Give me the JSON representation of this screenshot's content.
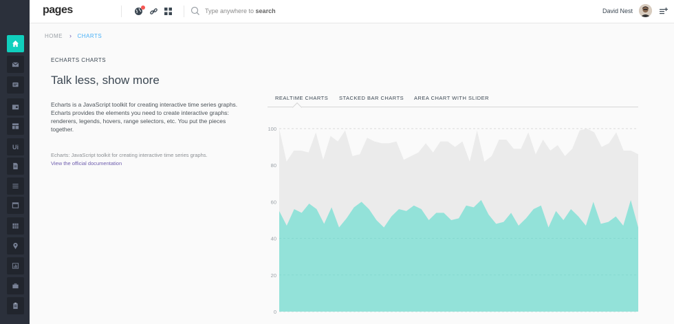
{
  "header": {
    "brand": "pages",
    "search_prefix": "Type anywhere to ",
    "search_keyword": "search",
    "user_name": "David Nest"
  },
  "breadcrumb": {
    "home": "HOME",
    "current": "CHARTS"
  },
  "content": {
    "section_label": "ECHARTS CHARTS",
    "title": "Talk less, show more",
    "description": "Echarts is a JavaScript toolkit for creating interactive time series graphs. Echarts provides the elements you need to create interactive graphs: renderers, legends, hovers, range selectors, etc. You put the pieces together.",
    "note": "Echarts: JavaScript toolkit for creating interactive time series graphs.",
    "doc_link": "View the official documentation"
  },
  "tabs": [
    {
      "label": "REALTIME CHARTS",
      "active": true
    },
    {
      "label": "STACKED BAR CHARTS",
      "active": false
    },
    {
      "label": "AREA CHART WITH SLIDER",
      "active": false
    }
  ],
  "sidebar": {
    "items": [
      "home-icon",
      "mail-icon",
      "chat-icon",
      "wallet-icon",
      "layout-icon",
      "ui-icon",
      "document-icon",
      "list-icon",
      "browser-icon",
      "table-icon",
      "map-pin-icon",
      "chart-icon",
      "briefcase-icon",
      "clipboard-icon"
    ]
  },
  "chart_data": {
    "type": "area",
    "ylim": [
      0,
      100
    ],
    "yticks": [
      "0",
      "20",
      "40",
      "60",
      "80",
      "100"
    ],
    "colors": {
      "series_1": "#93e2d9",
      "series_2": "#ebebeb"
    },
    "series": [
      {
        "values": [
          55,
          47,
          56,
          54,
          59,
          56,
          48,
          57,
          46,
          51,
          57,
          60,
          56,
          50,
          46,
          52,
          56,
          55,
          58,
          56,
          50,
          54,
          54,
          50,
          51,
          58,
          57,
          61,
          53,
          48,
          49,
          54,
          47,
          51,
          56,
          58,
          46,
          55,
          50,
          56,
          52,
          47,
          60,
          48,
          49,
          52,
          47,
          61,
          46
        ]
      },
      {
        "values": [
          100,
          82,
          88,
          88,
          87,
          98,
          83,
          96,
          93,
          99,
          85,
          86,
          95,
          93,
          92,
          92,
          93,
          83,
          85,
          87,
          92,
          87,
          93,
          93,
          90,
          93,
          82,
          99,
          82,
          85,
          94,
          94,
          89,
          89,
          98,
          86,
          94,
          88,
          91,
          85,
          89,
          99,
          100,
          98,
          90,
          92,
          98,
          88,
          88,
          86
        ]
      }
    ]
  }
}
